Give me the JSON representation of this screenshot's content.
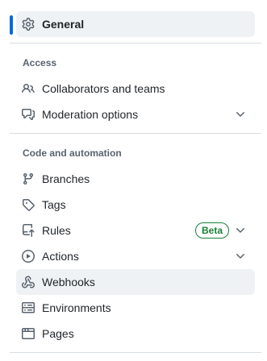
{
  "nav": {
    "general": {
      "label": "General",
      "icon": "gear-icon",
      "selected": true
    },
    "access": {
      "heading": "Access",
      "items": [
        {
          "label": "Collaborators and teams",
          "icon": "people-icon"
        },
        {
          "label": "Moderation options",
          "icon": "comment-discussion-icon",
          "expandable": true
        }
      ]
    },
    "code_and_automation": {
      "heading": "Code and automation",
      "items": [
        {
          "label": "Branches",
          "icon": "git-branch-icon"
        },
        {
          "label": "Tags",
          "icon": "tag-icon"
        },
        {
          "label": "Rules",
          "icon": "repo-push-icon",
          "badge": "Beta",
          "expandable": true
        },
        {
          "label": "Actions",
          "icon": "play-icon",
          "expandable": true
        },
        {
          "label": "Webhooks",
          "icon": "webhook-icon",
          "hovered": true
        },
        {
          "label": "Environments",
          "icon": "server-icon"
        },
        {
          "label": "Pages",
          "icon": "browser-icon"
        }
      ]
    }
  },
  "colors": {
    "accent": "#0969da",
    "badge_green": "#1a7f37",
    "hover_bg": "#eff2f5",
    "heading_text": "#59636e",
    "divider": "#d8dee4"
  }
}
